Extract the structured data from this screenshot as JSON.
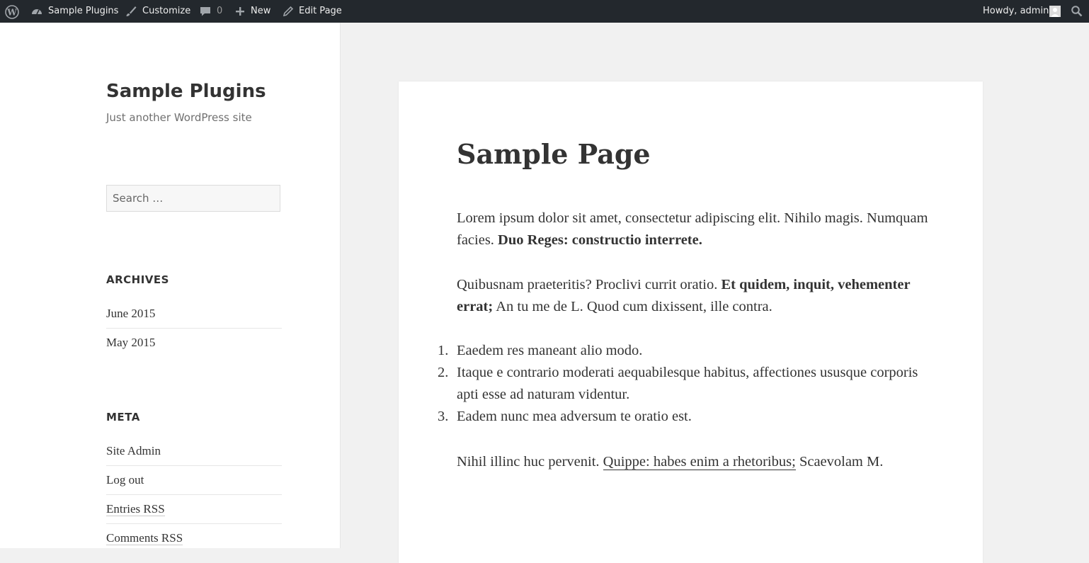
{
  "adminbar": {
    "site_name": "Sample Plugins",
    "customize": "Customize",
    "comments_count": "0",
    "new_label": "New",
    "edit_page": "Edit Page",
    "howdy": "Howdy, admin"
  },
  "sidebar": {
    "site_title": "Sample Plugins",
    "site_description": "Just another WordPress site",
    "search_placeholder": "Search …",
    "archives": {
      "title": "ARCHIVES",
      "items": [
        "June 2015",
        "May 2015"
      ]
    },
    "meta": {
      "title": "META",
      "items": [
        "Site Admin",
        "Log out",
        "Entries RSS",
        "Comments RSS"
      ]
    }
  },
  "content": {
    "title": "Sample Page",
    "p1": {
      "text": "Lorem ipsum dolor sit amet, consectetur adipiscing elit. Nihilo magis. Numquam facies. ",
      "bold": "Duo Reges: constructio interrete."
    },
    "p2": {
      "text": "Quibusnam praeteritis? Proclivi currit oratio. ",
      "bold": "Et quidem, inquit, vehementer errat;",
      "tail": " An tu me de L. Quod cum dixissent, ille contra."
    },
    "list": [
      {
        "num": "1.",
        "text": "Eaedem res maneant alio modo."
      },
      {
        "num": "2.",
        "text": "Itaque e contrario moderati aequabilesque habitus, affectiones ususque corporis apti esse ad naturam videntur."
      },
      {
        "num": "3.",
        "text": "Eadem nunc mea adversum te oratio est."
      }
    ],
    "p3": {
      "text": "Nihil illinc huc pervenit. ",
      "link": "Quippe: habes enim a rhetoribus;",
      "tail": " Scaevolam M."
    }
  }
}
